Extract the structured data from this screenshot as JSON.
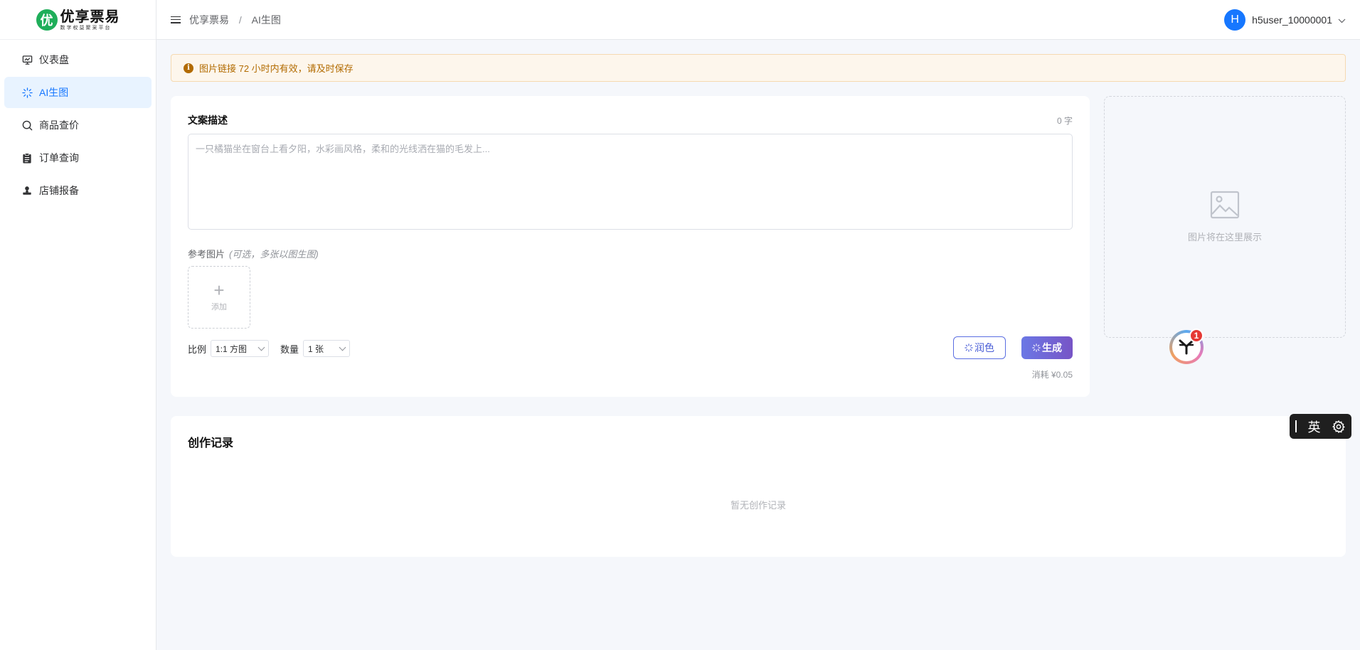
{
  "brand": {
    "title": "优享票易",
    "subtitle": "数字权益聚采平台",
    "badge": "优"
  },
  "sidebar": {
    "items": [
      {
        "label": "仪表盘",
        "icon": "dashboard-icon",
        "active": false
      },
      {
        "label": "AI生图",
        "icon": "sparkle-icon",
        "active": true
      },
      {
        "label": "商品查价",
        "icon": "search-icon",
        "active": false
      },
      {
        "label": "订单查询",
        "icon": "clipboard-icon",
        "active": false
      },
      {
        "label": "店铺报备",
        "icon": "stamp-icon",
        "active": false
      }
    ]
  },
  "header": {
    "breadcrumb": [
      "优享票易",
      "AI生图"
    ],
    "user": {
      "avatar": "H",
      "name": "h5user_10000001"
    }
  },
  "alert": {
    "text": "图片链接 72 小时内有效，请及时保存",
    "icon": "info-icon"
  },
  "generator": {
    "desc_label": "文案描述",
    "char_count": "0 字",
    "desc_placeholder": "一只橘猫坐在窗台上看夕阳，水彩画风格，柔和的光线洒在猫的毛发上...",
    "ref_label": "参考图片",
    "ref_hint": "(可选，多张以图生图)",
    "upload_label": "添加",
    "ratio_label": "比例",
    "ratio_value": "1:1 方图",
    "qty_label": "数量",
    "qty_value": "1 张",
    "polish_label": "润色",
    "generate_label": "生成",
    "cost": "消耗 ¥0.05"
  },
  "preview": {
    "text": "图片将在这里展示"
  },
  "records": {
    "title": "创作记录",
    "empty": "暂无创作记录"
  },
  "floating": {
    "notif_count": "1"
  },
  "ime": {
    "mode": "英"
  },
  "colors": {
    "primary": "#1677ff",
    "active_bg": "#e8f3ff",
    "warning_bg": "#fdf6ec",
    "warning_text": "#b26b00",
    "gen_start": "#6b78e5",
    "gen_end": "#7754c6"
  }
}
